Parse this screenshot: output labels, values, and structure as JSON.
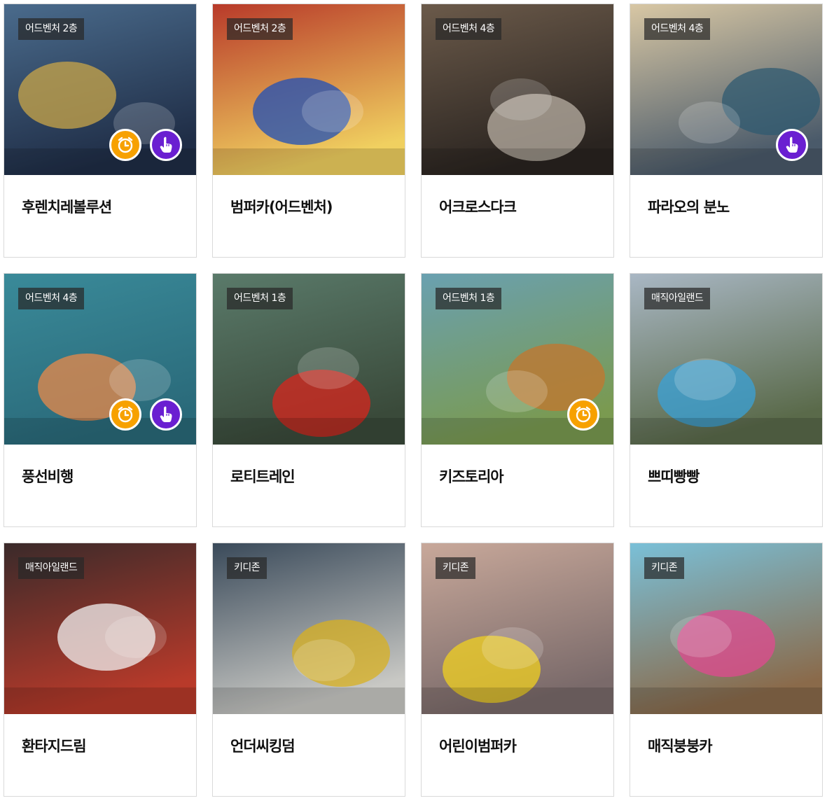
{
  "cards": [
    {
      "badge": "어드벤처 2층",
      "title": "후렌치레볼루션",
      "icons": [
        "clock-icon",
        "hand-icon"
      ],
      "bg": [
        "#4a6b8c",
        "#1f2d46"
      ],
      "accent": "#c9a648"
    },
    {
      "badge": "어드벤처 2층",
      "title": "범퍼카(어드벤처)",
      "icons": [],
      "bg": [
        "#b83a2a",
        "#f0d060"
      ],
      "accent": "#1d4fb8"
    },
    {
      "badge": "어드벤처 4층",
      "title": "어크로스다크",
      "icons": [],
      "bg": [
        "#6b5a4a",
        "#2a2420"
      ],
      "accent": "#b9b0a4"
    },
    {
      "badge": "어드벤처 4층",
      "title": "파라오의 분노",
      "icons": [
        "hand-icon"
      ],
      "bg": [
        "#d8c7a4",
        "#4a5a6a"
      ],
      "accent": "#2f5a70"
    },
    {
      "badge": "어드벤처 4층",
      "title": "풍선비행",
      "icons": [
        "clock-icon",
        "hand-icon"
      ],
      "bg": [
        "#3a8a99",
        "#2a6a7a"
      ],
      "accent": "#e98a4a"
    },
    {
      "badge": "어드벤처 1층",
      "title": "로티트레인",
      "icons": [],
      "bg": [
        "#5a7a6a",
        "#3a4a3a"
      ],
      "accent": "#d8261d"
    },
    {
      "badge": "어드벤처 1층",
      "title": "키즈토리아",
      "icons": [
        "clock-icon"
      ],
      "bg": [
        "#6aa0b0",
        "#7a9a50"
      ],
      "accent": "#c4762e"
    },
    {
      "badge": "매직아일랜드",
      "title": "쁘띠빵빵",
      "icons": [],
      "bg": [
        "#a9b7c4",
        "#5a6a4a"
      ],
      "accent": "#3aa2d8"
    },
    {
      "badge": "매직아일랜드",
      "title": "환타지드림",
      "icons": [],
      "bg": [
        "#3a2a2a",
        "#b83a2a"
      ],
      "accent": "#f2f2f2"
    },
    {
      "badge": "키디존",
      "title": "언더씨킹덤",
      "icons": [],
      "bg": [
        "#3a4a5a",
        "#c8c8c4"
      ],
      "accent": "#d8b020"
    },
    {
      "badge": "키디존",
      "title": "어린이범퍼카",
      "icons": [],
      "bg": [
        "#c8a89a",
        "#7a6a6a"
      ],
      "accent": "#f0d020"
    },
    {
      "badge": "키디존",
      "title": "매직붕붕카",
      "icons": [],
      "bg": [
        "#7ac0d8",
        "#8a6a4a"
      ],
      "accent": "#e04a90"
    }
  ]
}
